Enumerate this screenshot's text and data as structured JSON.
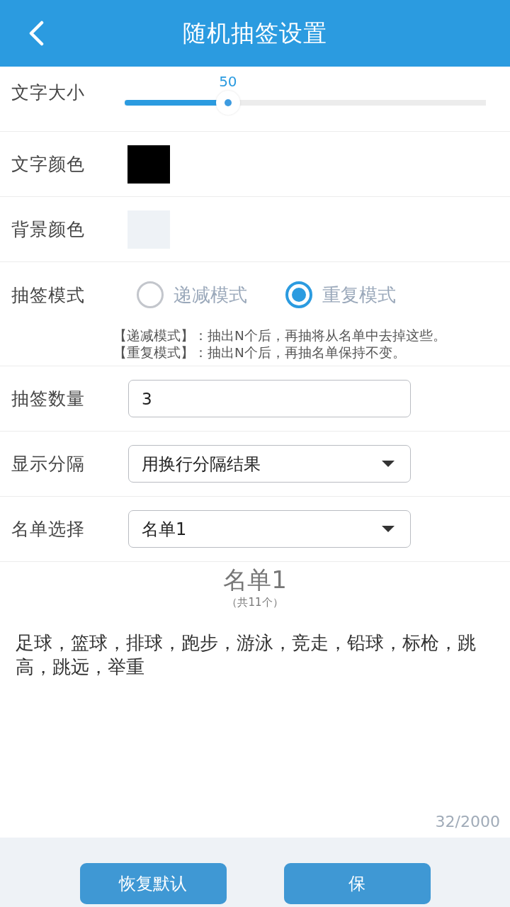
{
  "header": {
    "title": "随机抽签设置"
  },
  "settings": [
    {
      "kind": "slider",
      "label": "文字大小",
      "value": "50",
      "level": 0.286
    },
    {
      "kind": "color",
      "label": "文字颜色",
      "color": "#000000"
    },
    {
      "kind": "color",
      "label": "背景颜色",
      "color": "#eef2f6"
    },
    {
      "kind": "radio",
      "label": "抽签模式",
      "options": [
        {
          "label": "递减模式",
          "selected": false
        },
        {
          "label": "重复模式",
          "selected": true
        }
      ],
      "notes": [
        "【递减模式】：抽出N个后，再抽将从名单中去掉这些。",
        "【重复模式】：抽出N个后，再抽名单保持不变。"
      ]
    },
    {
      "kind": "input",
      "label": "抽签数量",
      "value": "3"
    },
    {
      "kind": "dropdown",
      "label": "显示分隔",
      "value": "用换行分隔结果"
    },
    {
      "kind": "dropdown",
      "label": "名单选择",
      "value": "名单1"
    }
  ],
  "list": {
    "title": "名单1",
    "count": "（共11个）",
    "text": "足球，篮球，排球，跑步，游泳，竞走，铅球，标枪，跳高，跳远，举重",
    "counter": "32/2000"
  },
  "buttons": [
    {
      "label": "恢复默认"
    },
    {
      "label": "保"
    }
  ]
}
